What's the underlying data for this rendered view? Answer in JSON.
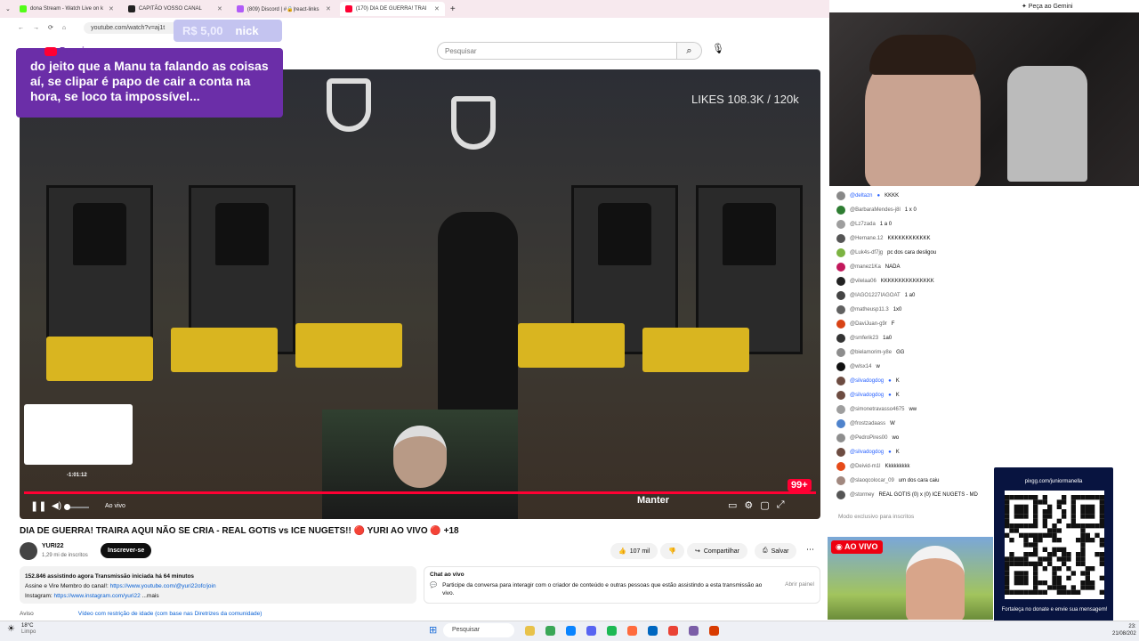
{
  "browser": {
    "tabs": [
      {
        "label": "dona Stream - Watch Live on k",
        "color": "#53fc18",
        "active": false
      },
      {
        "label": "CAPITÃO VOSSO CANAL",
        "color": "#222222",
        "active": false
      },
      {
        "label": "(809) Discord | #🔒|react-links",
        "color": "#b15cf7",
        "active": false
      },
      {
        "label": "(170) DIA DE GUERRA! TRAI",
        "color": "#ff0033",
        "active": true
      }
    ],
    "new_tab": "+",
    "url": "youtube.com/watch?v=aj1t"
  },
  "overlay": {
    "donation_amount": "R$ 5,00",
    "donation_name": "nick",
    "message": "do jeito que a Manu ta falando as coisas aí, se clipar é papo de cair a conta na hora, se loco ta impossível..."
  },
  "youtube": {
    "logo_text": "Premium",
    "search_placeholder": "Pesquisar"
  },
  "video": {
    "likes_overlay": "LIKES 108.3K / 120k",
    "timecode": "-1:01:12",
    "live_count_badge": "99+",
    "live_label": "Ao vivo",
    "manter_label": "Manter",
    "progress": 1.0
  },
  "info": {
    "title": "DIA DE GUERRA! TRAIRA AQUI NÃO SE CRIA - REAL GOTIS vs ICE NUGETS!! 🔴 YURI AO VIVO 🔴 +18",
    "channel": "YURI22",
    "subscribers": "1,29 mi de inscritos",
    "subscribe": "Inscrever-se",
    "likes": "107 mil",
    "share": "Compartilhar",
    "save": "Salvar",
    "desc_stats": "152.846 assistindo agora  Transmissão iniciada há 64 minutos",
    "desc_line2": "Assine e Vire Membro do canal!: ",
    "desc_link2": "https://www.youtube.com/@yuri22ofc/join",
    "desc_line3": "Instagram: ",
    "desc_link3": "https://www.instagram.com/yuri22",
    "desc_more": "...mais",
    "chat_title": "Chat ao vivo",
    "chat_desc": "Participe da conversa para interagir com o criador de conteúdo e outras pessoas que estão assistindo a esta transmissão ao vivo.",
    "chat_open": "Abrir painel",
    "notice": "Aviso",
    "notice_link": "Vídeo com restrição de idade (com base nas Diretrizes da comunidade)"
  },
  "stream": {
    "gemini": "✦ Peça ao Gemini",
    "chat": [
      {
        "name": "@deltazn",
        "text": "KKKK",
        "mod": true,
        "color": "#888888"
      },
      {
        "name": "@BarbaraMendes-j8l",
        "text": "1 x 0",
        "mod": false,
        "color": "#2e7d32"
      },
      {
        "name": "@Lz7zada",
        "text": "1 a 0",
        "mod": false,
        "color": "#9e9e9e"
      },
      {
        "name": "@Hernane.12",
        "text": "KKKKKKKKKKKK",
        "mod": false,
        "color": "#555555"
      },
      {
        "name": "@Luk4s-df7jg",
        "text": "pc dos cara desligou",
        "mod": false,
        "color": "#7cb342"
      },
      {
        "name": "@manez1Ka",
        "text": "NADA",
        "mod": false,
        "color": "#c2185b"
      },
      {
        "name": "@vilelaa06",
        "text": "KKKKKKKKKKKKKKK",
        "mod": false,
        "color": "#222222"
      },
      {
        "name": "@IAGO1227IAGOAT",
        "text": "1 a0",
        "mod": false,
        "color": "#444444"
      },
      {
        "name": "@matheusp11.3",
        "text": "1x0",
        "mod": false,
        "color": "#616161"
      },
      {
        "name": "@DaviJuan-g9r",
        "text": "F",
        "mod": false,
        "color": "#d84315"
      },
      {
        "name": "@smferik23",
        "text": "1a0",
        "mod": false,
        "color": "#333333"
      },
      {
        "name": "@bielamorim-y8e",
        "text": "GG",
        "mod": false,
        "color": "#8d8d8d"
      },
      {
        "name": "@wlsx14",
        "text": "w",
        "mod": false,
        "color": "#111111"
      },
      {
        "name": "@silvadogdog",
        "text": "K",
        "mod": true,
        "color": "#6d4c41"
      },
      {
        "name": "@silvadogdog",
        "text": "K",
        "mod": true,
        "color": "#6d4c41"
      },
      {
        "name": "@simonetravasso4675",
        "text": "ww",
        "mod": false,
        "color": "#9e9e9e"
      },
      {
        "name": "@frostzadaass",
        "text": "W",
        "mod": false,
        "color": "#4f83cc"
      },
      {
        "name": "@PedroPires00",
        "text": "wo",
        "mod": false,
        "color": "#8e8e8e"
      },
      {
        "name": "@silvadogdog",
        "text": "K",
        "mod": true,
        "color": "#6d4c41"
      },
      {
        "name": "@Deivid-m1l",
        "text": "Kkkkkkkkk",
        "mod": false,
        "color": "#e64a19"
      },
      {
        "name": "@slaoqcolocar_09",
        "text": "um dos cara caiu",
        "mod": false,
        "color": "#a1887f"
      },
      {
        "name": "@stormey",
        "text": "REAL GOTIS (0) x (0) ICE NUGETS - MD",
        "mod": false,
        "color": "#555555"
      }
    ],
    "chat_input": "Modo exclusivo para inscritos",
    "qr_url": "pixgg.com/juniormanella",
    "qr_note": "Fortaleça no donate e envie sua mensagem!",
    "live_badge": "◉ AO VIVO"
  },
  "taskbar": {
    "temp": "18°C",
    "weather": "Limpo",
    "search": "Pesquisar",
    "time": "23:",
    "date": "21/08/202"
  }
}
